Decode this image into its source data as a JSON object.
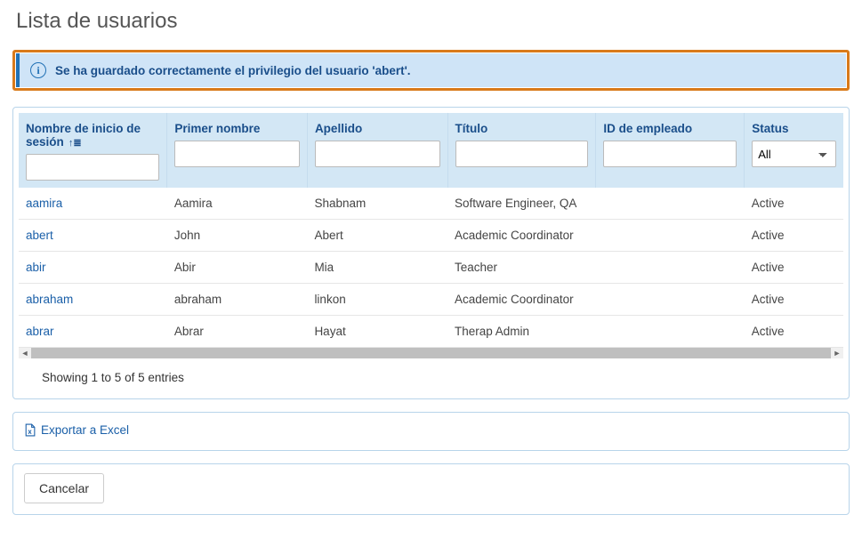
{
  "page_title": "Lista de usuarios",
  "alert": {
    "message": "Se ha guardado correctamente el privilegio del usuario 'abert'."
  },
  "table": {
    "columns": {
      "login": "Nombre de inicio de sesión",
      "first": "Primer nombre",
      "last": "Apellido",
      "title": "Título",
      "employee": "ID de empleado",
      "status": "Status"
    },
    "status_filter": {
      "selected": "All",
      "options": [
        "All"
      ]
    },
    "rows": [
      {
        "login": "aamira",
        "first": "Aamira",
        "last": "Shabnam",
        "title": "Software Engineer, QA",
        "employee": "",
        "status": "Active"
      },
      {
        "login": "abert",
        "first": "John",
        "last": "Abert",
        "title": "Academic Coordinator",
        "employee": "",
        "status": "Active"
      },
      {
        "login": "abir",
        "first": "Abir",
        "last": "Mia",
        "title": "Teacher",
        "employee": "",
        "status": "Active"
      },
      {
        "login": "abraham",
        "first": "abraham",
        "last": "linkon",
        "title": "Academic Coordinator",
        "employee": "",
        "status": "Active"
      },
      {
        "login": "abrar",
        "first": "Abrar",
        "last": "Hayat",
        "title": "Therap Admin",
        "employee": "",
        "status": "Active"
      }
    ],
    "entries_info": "Showing 1 to 5 of 5 entries"
  },
  "export_label": "Exportar a Excel",
  "cancel_label": "Cancelar"
}
